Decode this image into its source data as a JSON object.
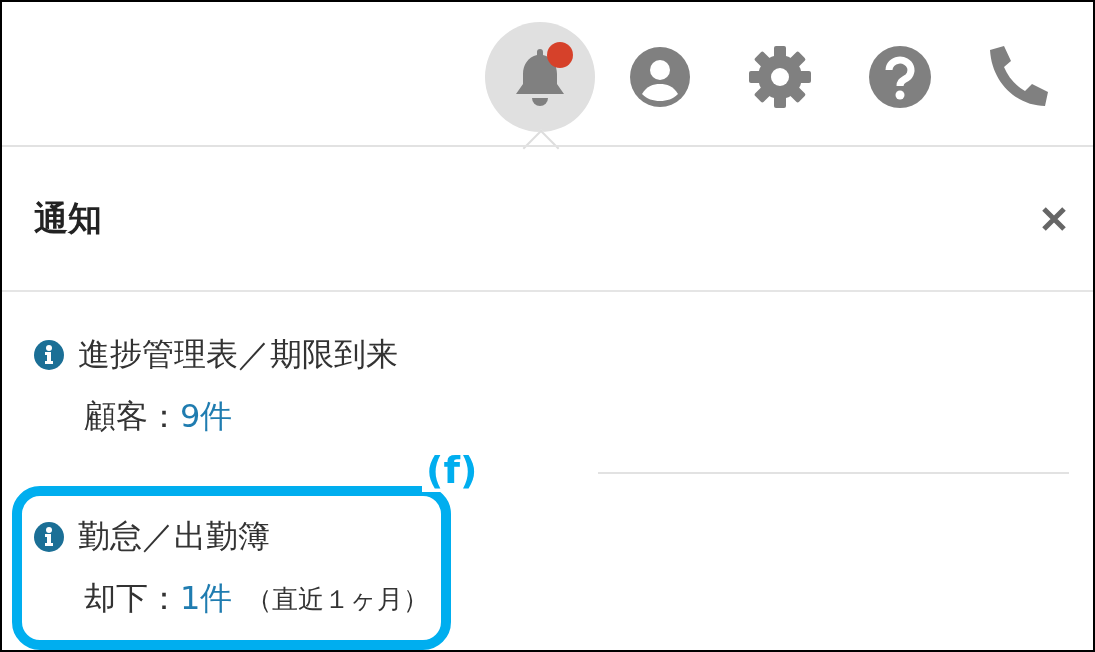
{
  "toolbar": {
    "icons": [
      {
        "kind": "bell",
        "selected": true,
        "badge": true
      },
      {
        "kind": "user",
        "selected": false,
        "badge": false
      },
      {
        "kind": "gear",
        "selected": false,
        "badge": false
      },
      {
        "kind": "help",
        "selected": false,
        "badge": false
      },
      {
        "kind": "phone",
        "selected": false,
        "badge": false
      }
    ]
  },
  "notifications": {
    "title": "通知",
    "items": [
      {
        "title": "進捗管理表／期限到来",
        "label": "顧客：",
        "count": "9件"
      },
      {
        "title": "勤怠／出勤簿",
        "label": "却下：",
        "count": "1件",
        "note": "（直近１ヶ月）",
        "callout": {
          "label": "(f)"
        }
      }
    ]
  }
}
